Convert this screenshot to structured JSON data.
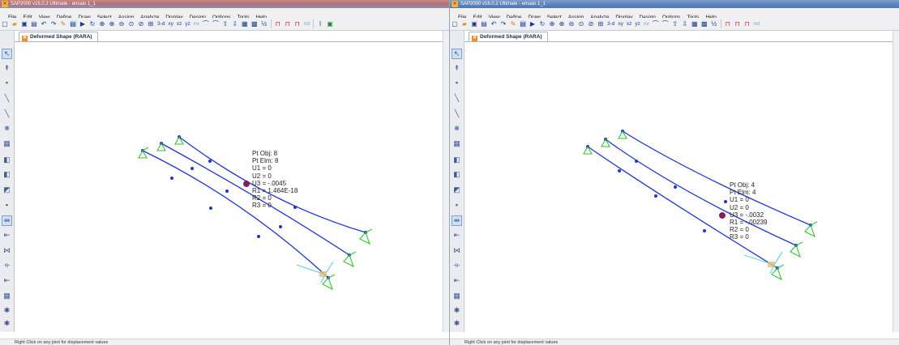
{
  "windows": [
    {
      "title": "SAP2000 v16.0.2 Ultimate  - ensaio 1_1",
      "menu": [
        "File",
        "Edit",
        "View",
        "Define",
        "Draw",
        "Select",
        "Assign",
        "Analyze",
        "Display",
        "Design",
        "Options",
        "Tools",
        "Help"
      ],
      "toolbar": {
        "view_buttons": [
          "3-d",
          "xy",
          "xz",
          "yz",
          "nv"
        ],
        "more_label": "nd"
      },
      "tab_label": "Deformed Shape (RARA)",
      "joint_info": {
        "pt_obj": "Pt Obj: 8",
        "pt_elm": "Pt Elm: 8",
        "u1": "U1 = 0",
        "u2": "U2 = 0",
        "u3": "U3 = -.0045",
        "r1": "R1 = 1.464E-18",
        "r2": "R2 = 0",
        "r3": "R3 = 0"
      },
      "status_text": "Right Click on any joint for displacement values"
    },
    {
      "title": "SAP2000 v16.0.2 Ultimate  - ensaio 1_1",
      "menu": [
        "File",
        "Edit",
        "View",
        "Define",
        "Draw",
        "Select",
        "Assign",
        "Analyze",
        "Display",
        "Design",
        "Options",
        "Tools",
        "Help"
      ],
      "toolbar": {
        "view_buttons": [
          "3-d",
          "xy",
          "xz",
          "yz",
          "nv"
        ],
        "more_label": "nd"
      },
      "tab_label": "Deformed Shape (RARA)",
      "joint_info": {
        "pt_obj": "Pt Obj: 4",
        "pt_elm": "Pt Elm: 4",
        "u1": "U1 = 0",
        "u2": "U2 = 0",
        "u3": "U3 = -.0032",
        "r1": "R1 = -.00239",
        "r2": "R2 = 0",
        "r3": "R3 = 0"
      },
      "status_text": "Right Click on any joint for displacement values"
    }
  ],
  "colors": {
    "member": "#2133d6",
    "joint": "#2133d6",
    "selected_joint": "#8a1a5a",
    "support": "#33c233",
    "axis": "#36c8e6"
  }
}
